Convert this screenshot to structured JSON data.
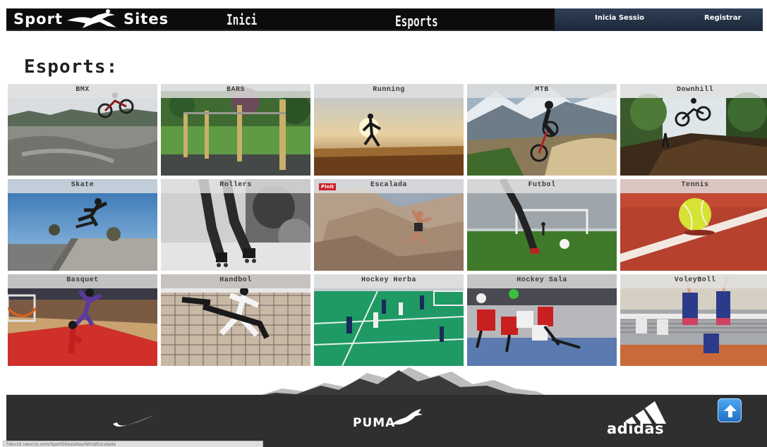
{
  "header": {
    "logo_left": "Sport",
    "logo_right": "Sites",
    "nav_home": "Inici",
    "nav_sports": "Esports",
    "login": "Inicia Sessio",
    "register": "Registrar"
  },
  "page": {
    "title": "Esports:"
  },
  "sports": [
    {
      "label": "BMX"
    },
    {
      "label": "BARS"
    },
    {
      "label": "Running"
    },
    {
      "label": "MTB"
    },
    {
      "label": "Downhill"
    },
    {
      "label": "Skate"
    },
    {
      "label": "Rollers"
    },
    {
      "label": "Escalada",
      "badge": "Pinit"
    },
    {
      "label": "Futbol"
    },
    {
      "label": "Tennis"
    },
    {
      "label": "Basquet"
    },
    {
      "label": "Handbol"
    },
    {
      "label": "Hockey Herba"
    },
    {
      "label": "Hockey Sala"
    },
    {
      "label": "VoleyBoll"
    }
  ],
  "footer": {
    "brands": [
      "nike-swoosh",
      "PUMA",
      "adidas"
    ],
    "puma": "PUMA",
    "adidas": "adidas",
    "status_url": "7dev16.neocrio.com/SportSites/sites/Wind/Escalada"
  },
  "colors": {
    "header_bg": "#0c0c0c",
    "auth_bg": "#2f3f55",
    "footer_bg": "#2f2f2f",
    "up_button": "#1f6fc4"
  }
}
